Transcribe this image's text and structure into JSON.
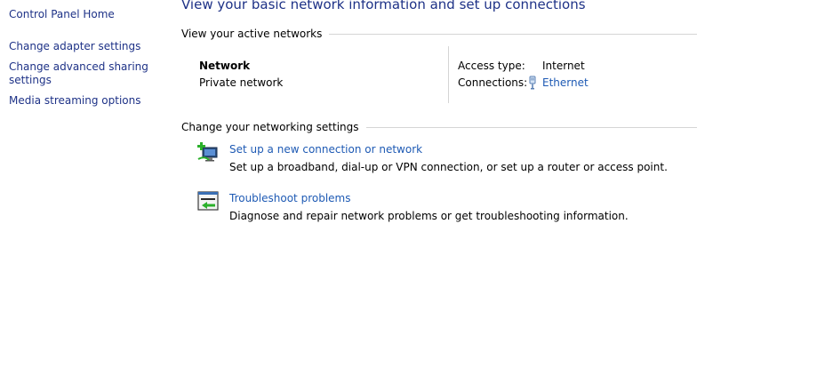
{
  "sidebar": {
    "items": [
      {
        "label": "Control Panel Home"
      },
      {
        "label": "Change adapter settings"
      },
      {
        "label": "Change advanced sharing settings"
      },
      {
        "label": "Media streaming options"
      }
    ]
  },
  "main": {
    "title": "View your basic network information and set up connections",
    "active_networks": {
      "header": "View your active networks",
      "network_name": "Network",
      "network_category": "Private network",
      "access_type_label": "Access type:",
      "access_type_value": "Internet",
      "connections_label": "Connections:",
      "connection_name": "Ethernet"
    },
    "networking_settings": {
      "header": "Change your networking settings",
      "tasks": [
        {
          "icon": "new-connection-icon",
          "link": "Set up a new connection or network",
          "description": "Set up a broadband, dial-up or VPN connection, or set up a router or access point."
        },
        {
          "icon": "troubleshoot-icon",
          "link": "Troubleshoot problems",
          "description": "Diagnose and repair network problems or get troubleshooting information."
        }
      ]
    }
  },
  "colors": {
    "link": "#1e5ab4",
    "nav_link": "#1e3287",
    "divider": "#d5d5d5"
  }
}
